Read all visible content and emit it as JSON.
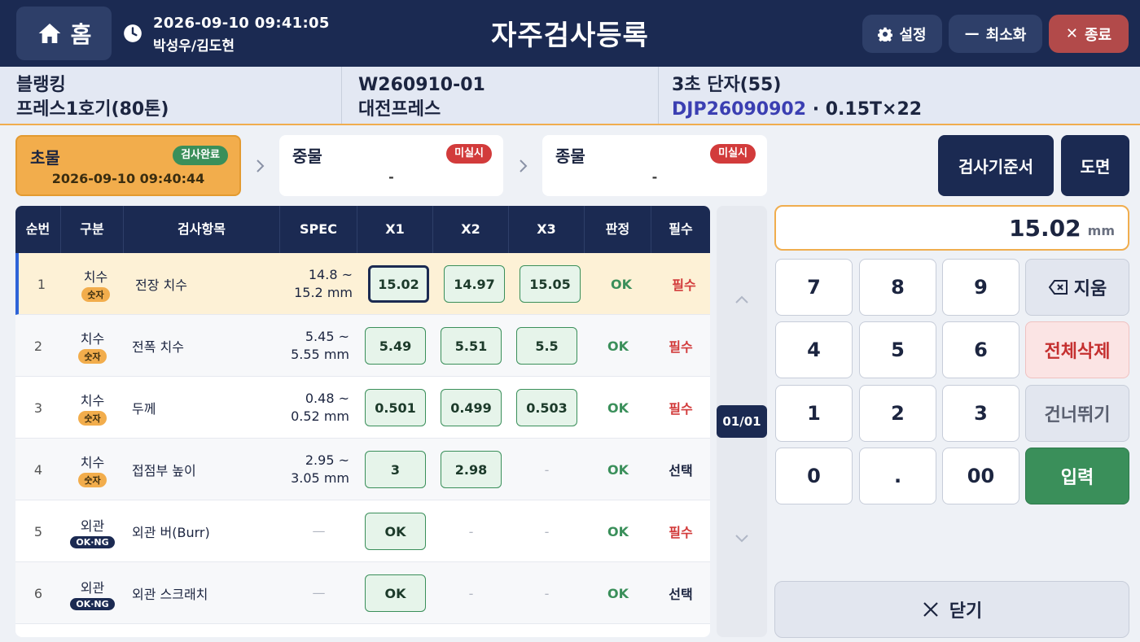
{
  "header": {
    "home_label": "홈",
    "datetime": "2026-09-10 09:41:05",
    "users": "박성우/김도현",
    "title": "자주검사등록",
    "settings_label": "설정",
    "minimize_label": "최소화",
    "close_label": "종료"
  },
  "info": {
    "process": "블랭킹",
    "machine": "프레스1호기(80톤)",
    "work_order": "W260910-01",
    "company": "대전프레스",
    "product": "3초 단자(55)",
    "lot": "DJP26090902",
    "spec_suffix": "· 0.15T×22"
  },
  "stages": [
    {
      "name": "초물",
      "status": "검사완료",
      "time": "2026-09-10 09:40:44"
    },
    {
      "name": "중물",
      "status": "미실시",
      "time": "-"
    },
    {
      "name": "종물",
      "status": "미실시",
      "time": "-"
    }
  ],
  "table": {
    "headers": [
      "순번",
      "구분",
      "검사항목",
      "SPEC",
      "X1",
      "X2",
      "X3",
      "판정",
      "필수"
    ],
    "rows": [
      {
        "no": "1",
        "type": "치수",
        "badge": "숫자",
        "item": "전장 치수",
        "spec1": "14.8 ~",
        "spec2": "15.2 mm",
        "x1": "15.02",
        "x2": "14.97",
        "x3": "15.05",
        "judge": "OK",
        "req": "필수"
      },
      {
        "no": "2",
        "type": "치수",
        "badge": "숫자",
        "item": "전폭 치수",
        "spec1": "5.45 ~",
        "spec2": "5.55 mm",
        "x1": "5.49",
        "x2": "5.51",
        "x3": "5.5",
        "judge": "OK",
        "req": "필수"
      },
      {
        "no": "3",
        "type": "치수",
        "badge": "숫자",
        "item": "두께",
        "spec1": "0.48 ~",
        "spec2": "0.52 mm",
        "x1": "0.501",
        "x2": "0.499",
        "x3": "0.503",
        "judge": "OK",
        "req": "필수"
      },
      {
        "no": "4",
        "type": "치수",
        "badge": "숫자",
        "item": "접점부 높이",
        "spec1": "2.95 ~",
        "spec2": "3.05 mm",
        "x1": "3",
        "x2": "2.98",
        "x3": "-",
        "judge": "OK",
        "req": "선택"
      },
      {
        "no": "5",
        "type": "외관",
        "badge": "OK·NG",
        "item": "외관 버(Burr)",
        "spec1": "—",
        "spec2": "",
        "x1": "OK",
        "x2": "-",
        "x3": "-",
        "judge": "OK",
        "req": "필수"
      },
      {
        "no": "6",
        "type": "외관",
        "badge": "OK·NG",
        "item": "외관 스크래치",
        "spec1": "—",
        "spec2": "",
        "x1": "OK",
        "x2": "-",
        "x3": "-",
        "judge": "OK",
        "req": "선택"
      }
    ]
  },
  "pager": "01/01",
  "panel": {
    "std_doc_label": "검사기준서",
    "drawing_label": "도면",
    "display_value": "15.02",
    "display_unit": "mm",
    "keys": [
      "7",
      "8",
      "9",
      "4",
      "5",
      "6",
      "1",
      "2",
      "3",
      "0",
      ".",
      "00"
    ],
    "backspace_label": "지움",
    "clearall_label": "전체삭제",
    "skip_label": "건너뛰기",
    "enter_label": "입력",
    "close_label": "닫기"
  }
}
